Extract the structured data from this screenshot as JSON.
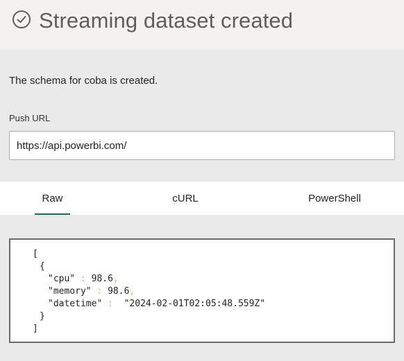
{
  "header": {
    "title": "Streaming dataset created",
    "icon": "checkmark-circle-icon"
  },
  "description": "The schema for coba is created.",
  "push_url": {
    "label": "Push URL",
    "value": "https://api.powerbi.com/"
  },
  "tabs": [
    {
      "label": "Raw",
      "active": true
    },
    {
      "label": "cURL",
      "active": false
    },
    {
      "label": "PowerShell",
      "active": false
    }
  ],
  "code": {
    "open_bracket": "[",
    "open_brace": "{",
    "fields": [
      {
        "key": "\"cpu\"",
        "value": "98.6",
        "comma": ","
      },
      {
        "key": "\"memory\"",
        "value": "98.6",
        "comma": ","
      },
      {
        "key": "\"datetime\"",
        "value": "\"2024-02-01T02:05:48.559Z\"",
        "comma": ""
      }
    ],
    "colon": ":",
    "close_brace": "}",
    "close_bracket": "]"
  },
  "colors": {
    "accent": "#1b6b54",
    "punctuation": "#e8a87c"
  }
}
